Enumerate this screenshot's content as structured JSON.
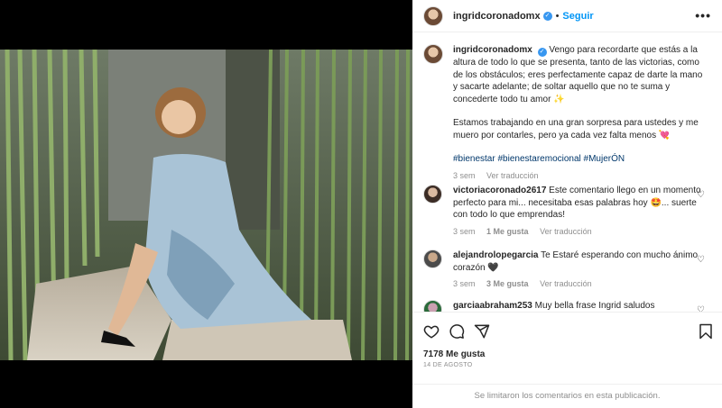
{
  "post": {
    "username": "ingridcoronadomx",
    "follow_label": "Seguir",
    "separator": "•",
    "more_label": "•••",
    "verified_glyph": "✓"
  },
  "caption": {
    "username": "ingridcoronadomx",
    "text_1": "Vengo para recordarte que estás a la altura de todo lo que se presenta, tanto de las victorias, como de los obstáculos; eres perfectamente capaz de darte la mano y sacarte adelante; de soltar aquello que no te suma y concederte todo tu amor ✨",
    "text_2": "Estamos trabajando en una gran sorpresa para ustedes y me muero por contarles, pero ya cada vez falta menos 💘",
    "hashtags": "#bienestar #bienestaremocional #MujerÓN",
    "time": "3 sem",
    "translate": "Ver traducción"
  },
  "comments": [
    {
      "username": "victoriacoronado2617",
      "text": "Este comentario llego en un momento perfecto para mi... necesitaba esas palabras hoy 🤩... suerte con todo lo que emprendas!",
      "time": "3 sem",
      "likes": "1 Me gusta",
      "translate": "Ver traducción"
    },
    {
      "username": "alejandrolopegarcia",
      "text": "Te Estaré esperando con mucho ánimo corazón 🖤",
      "time": "3 sem",
      "likes": "3 Me gusta",
      "translate": "Ver traducción"
    },
    {
      "username": "garciaabraham253",
      "text": "Muy bella frase Ingrid saludos"
    }
  ],
  "actions": {
    "likes": "7178 Me gusta",
    "date": "14 DE AGOSTO"
  },
  "footer": {
    "limited": "Se limitaron los comentarios en esta publicación."
  },
  "colors": {
    "accent": "#0095f6",
    "verified": "#3897f0",
    "hashtag": "#00376b",
    "muted": "#8e8e8e"
  },
  "icons": [
    "heart-icon",
    "comment-icon",
    "share-icon",
    "bookmark-icon",
    "more-icon",
    "verified-icon"
  ]
}
